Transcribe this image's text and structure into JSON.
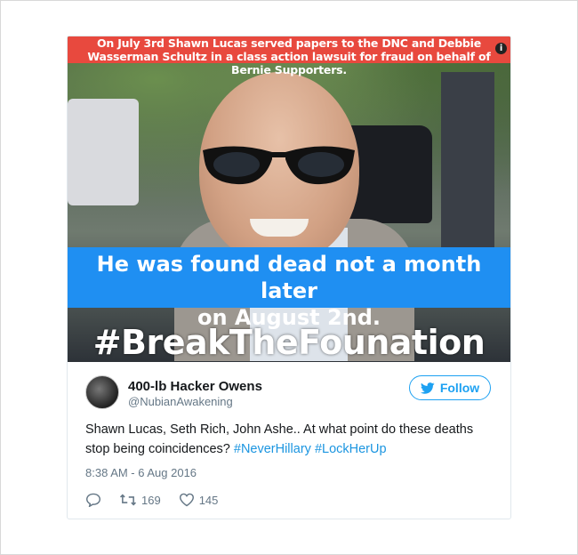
{
  "media": {
    "top_banner": "On July 3rd Shawn Lucas served papers to the DNC and Debbie Wasserman Schultz in a class action lawsuit for fraud on behalf of Bernie Supporters.",
    "middle_banner_line1": "He was found dead not a month later",
    "middle_banner_line2": "on August 2nd.",
    "hashtag": "#BreakTheFounation",
    "info_icon_label": "i"
  },
  "author": {
    "name": "400-lb Hacker Owens",
    "handle": "@NubianAwakening"
  },
  "follow_button": {
    "label": "Follow",
    "color": "#1da1f2"
  },
  "tweet": {
    "text": "Shawn Lucas, Seth Rich, John Ashe.. At what point do these deaths stop being coincidences? ",
    "hashtags": [
      "#NeverHillary",
      "#LockHerUp"
    ],
    "timestamp": "8:38 AM - 6 Aug 2016"
  },
  "actions": {
    "retweets": "169",
    "likes": "145"
  },
  "colors": {
    "top_banner": "#e8493e",
    "middle_banner": "#1f8ff2",
    "link": "#1b95e0"
  }
}
